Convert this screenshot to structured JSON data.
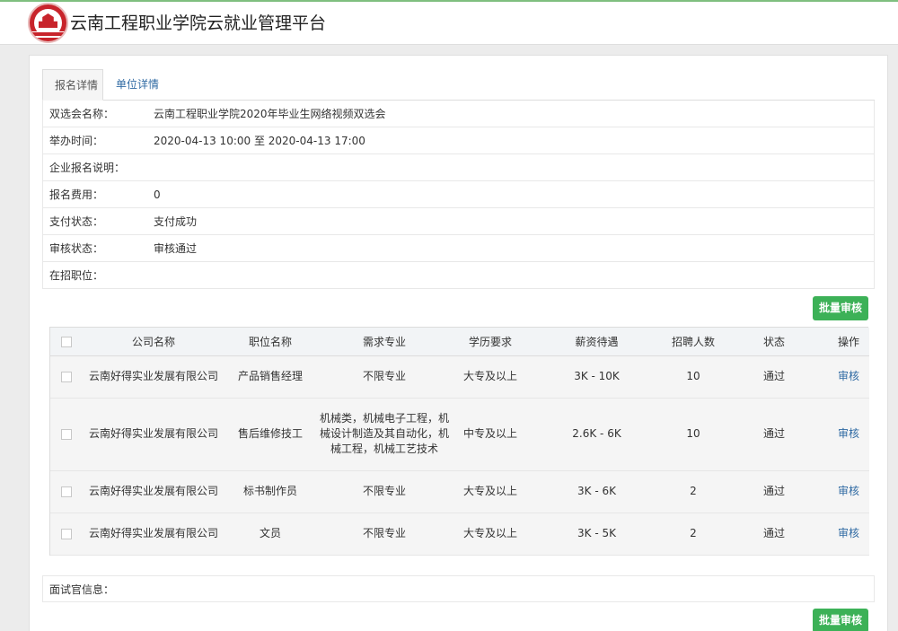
{
  "header": {
    "title": "云南工程职业学院云就业管理平台"
  },
  "tabs": [
    {
      "label": "报名详情"
    },
    {
      "label": "单位详情"
    }
  ],
  "info": {
    "rows": [
      {
        "label": "双选会名称：",
        "value": "云南工程职业学院2020年毕业生网络视频双选会"
      },
      {
        "label": "举办时间：",
        "value": "2020-04-13 10:00 至 2020-04-13 17:00"
      },
      {
        "label": "企业报名说明：",
        "value": ""
      },
      {
        "label": "报名费用：",
        "value": "0"
      },
      {
        "label": "支付状态：",
        "value": "支付成功"
      },
      {
        "label": "审核状态：",
        "value": "审核通过"
      },
      {
        "label": "在招职位：",
        "value": ""
      }
    ]
  },
  "batch_button_label": "批量审核",
  "table": {
    "columns": [
      "公司名称",
      "职位名称",
      "需求专业",
      "学历要求",
      "薪资待遇",
      "招聘人数",
      "状态",
      "操作"
    ],
    "rows": [
      {
        "company": "云南好得实业发展有限公司",
        "position": "产品销售经理",
        "major": "不限专业",
        "education": "大专及以上",
        "salary": "3K - 10K",
        "count": "10",
        "status": "通过",
        "action": "审核"
      },
      {
        "company": "云南好得实业发展有限公司",
        "position": "售后维修技工",
        "major": "机械类，机械电子工程，机械设计制造及其自动化，机械工程，机械工艺技术",
        "education": "中专及以上",
        "salary": "2.6K - 6K",
        "count": "10",
        "status": "通过",
        "action": "审核"
      },
      {
        "company": "云南好得实业发展有限公司",
        "position": "标书制作员",
        "major": "不限专业",
        "education": "大专及以上",
        "salary": "3K - 6K",
        "count": "2",
        "status": "通过",
        "action": "审核"
      },
      {
        "company": "云南好得实业发展有限公司",
        "position": "文员",
        "major": "不限专业",
        "education": "大专及以上",
        "salary": "3K - 5K",
        "count": "2",
        "status": "通过",
        "action": "审核"
      }
    ]
  },
  "interviewer": {
    "label": "面试官信息："
  }
}
